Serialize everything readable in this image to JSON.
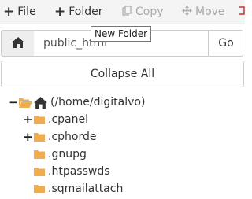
{
  "toolbar": {
    "file_label": "File",
    "new_folder_label": "Folder",
    "copy_label": "Copy",
    "move_label": "Move"
  },
  "tooltip": {
    "text": "New Folder"
  },
  "pathbar": {
    "value": "public_html",
    "go_label": "Go"
  },
  "collapse": {
    "label": "Collapse All"
  },
  "tree": {
    "root_label": "(/home/digitalvo)",
    "items": [
      {
        "label": ".cpanel",
        "expandable": true
      },
      {
        "label": ".cphorde",
        "expandable": true
      },
      {
        "label": ".gnupg",
        "expandable": false
      },
      {
        "label": ".htpasswds",
        "expandable": false
      },
      {
        "label": ".sqmailattach",
        "expandable": false
      }
    ]
  },
  "colors": {
    "folder": "#f0ad4e",
    "toolbar_bg": "#f4f4f4",
    "disabled_text": "#aaaaaa",
    "border": "#cccccc"
  }
}
